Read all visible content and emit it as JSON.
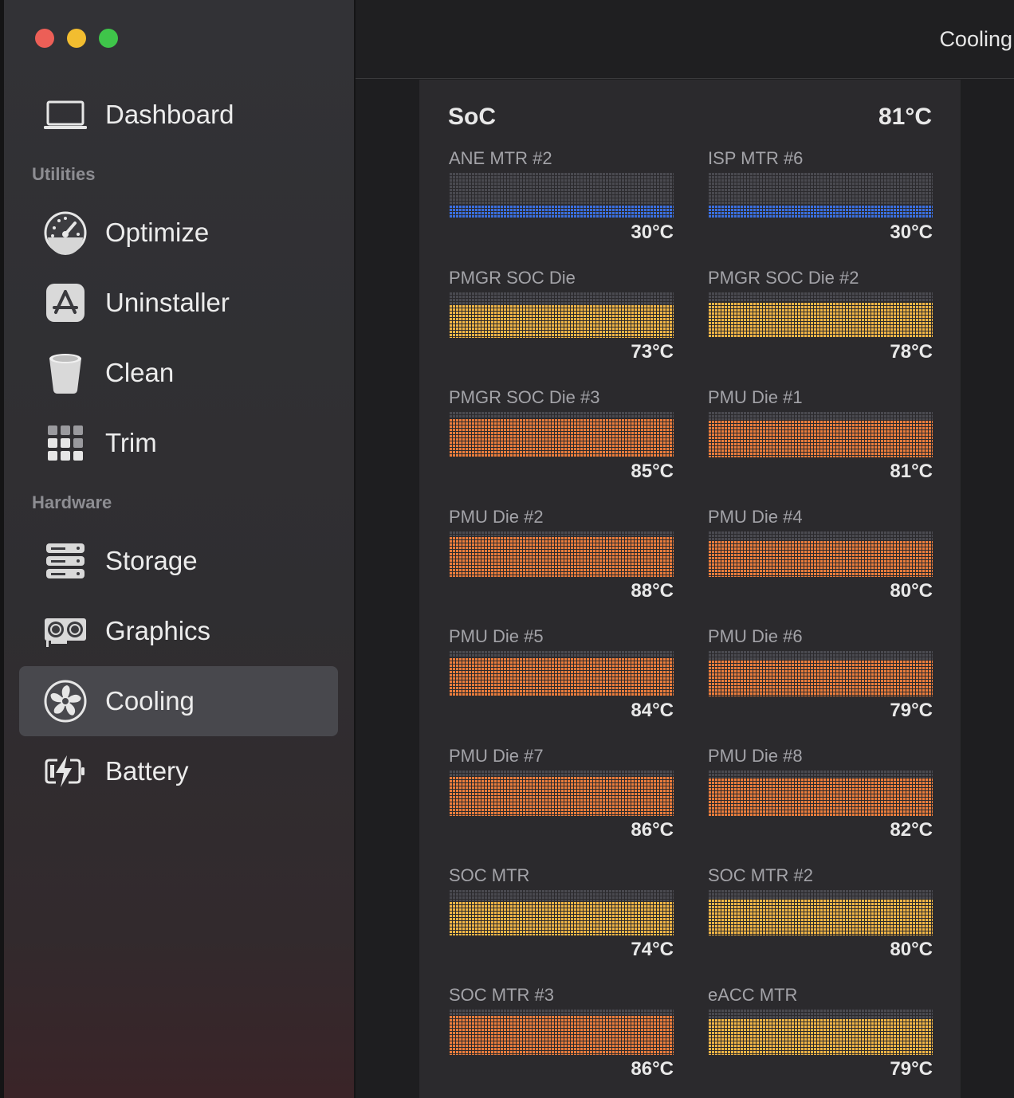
{
  "window": {
    "title": "Cooling"
  },
  "sidebar": {
    "top_item": {
      "label": "Dashboard",
      "icon": "laptop-icon"
    },
    "sections": [
      {
        "label": "Utilities",
        "items": [
          {
            "label": "Optimize",
            "icon": "speedometer-icon"
          },
          {
            "label": "Uninstaller",
            "icon": "app-store-icon"
          },
          {
            "label": "Clean",
            "icon": "trash-bin-icon"
          },
          {
            "label": "Trim",
            "icon": "grid-icon"
          }
        ]
      },
      {
        "label": "Hardware",
        "items": [
          {
            "label": "Storage",
            "icon": "server-icon"
          },
          {
            "label": "Graphics",
            "icon": "graphics-card-icon"
          },
          {
            "label": "Cooling",
            "icon": "fan-icon",
            "active": true
          },
          {
            "label": "Battery",
            "icon": "battery-bolt-icon"
          }
        ]
      }
    ]
  },
  "panel": {
    "title": "SoC",
    "value": "81°C",
    "sensors": [
      {
        "name": "ANE MTR #2",
        "temp": "30°C",
        "level": 0.3,
        "color": "#3a6fe0"
      },
      {
        "name": "ISP MTR #6",
        "temp": "30°C",
        "level": 0.3,
        "color": "#3a6fe0"
      },
      {
        "name": "PMGR SOC Die",
        "temp": "73°C",
        "level": 0.73,
        "color": "#f2b646"
      },
      {
        "name": "PMGR SOC Die #2",
        "temp": "78°C",
        "level": 0.78,
        "color": "#f2b646"
      },
      {
        "name": "PMGR SOC Die #3",
        "temp": "85°C",
        "level": 0.85,
        "color": "#ec7d3c"
      },
      {
        "name": "PMU Die #1",
        "temp": "81°C",
        "level": 0.81,
        "color": "#ec7d3c"
      },
      {
        "name": "PMU Die #2",
        "temp": "88°C",
        "level": 0.88,
        "color": "#ec7d3c"
      },
      {
        "name": "PMU Die #4",
        "temp": "80°C",
        "level": 0.8,
        "color": "#ec7d3c"
      },
      {
        "name": "PMU Die #5",
        "temp": "84°C",
        "level": 0.84,
        "color": "#ec7d3c"
      },
      {
        "name": "PMU Die #6",
        "temp": "79°C",
        "level": 0.79,
        "color": "#ec7d3c"
      },
      {
        "name": "PMU Die #7",
        "temp": "86°C",
        "level": 0.86,
        "color": "#ec7d3c"
      },
      {
        "name": "PMU Die #8",
        "temp": "82°C",
        "level": 0.82,
        "color": "#ec7d3c"
      },
      {
        "name": "SOC MTR",
        "temp": "74°C",
        "level": 0.74,
        "color": "#f2b646"
      },
      {
        "name": "SOC MTR #2",
        "temp": "80°C",
        "level": 0.8,
        "color": "#f2b646"
      },
      {
        "name": "SOC MTR #3",
        "temp": "86°C",
        "level": 0.86,
        "color": "#ec7d3c"
      },
      {
        "name": "eACC MTR",
        "temp": "79°C",
        "level": 0.79,
        "color": "#f2b646"
      }
    ]
  }
}
